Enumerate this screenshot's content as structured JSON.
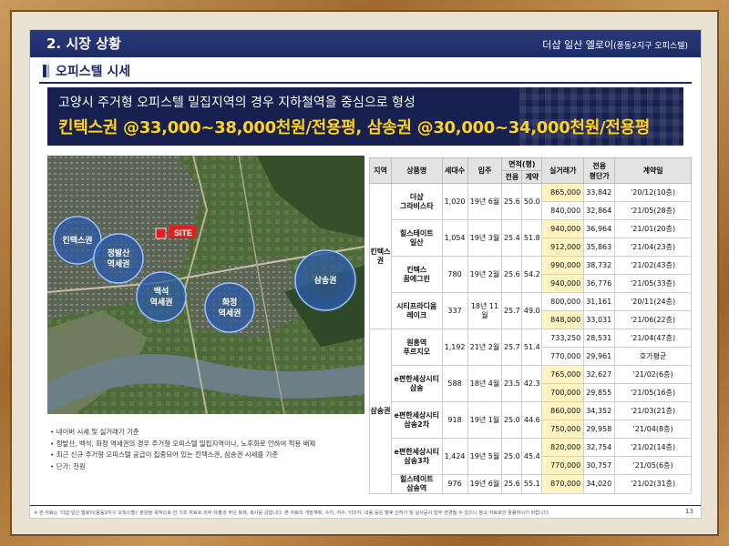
{
  "header": {
    "section": "2. 시장 상황",
    "project_main": "더샵 일산 엘로이",
    "project_sub": "(풍동2지구 오피스텔)"
  },
  "subheader": "오피스텔 시세",
  "banner": {
    "line1": "고양시 주거형 오피스텔 밀집지역의 경우 지하철역을 중심으로 형성",
    "line2": "킨텍스권 @33,000~38,000천원/전용평, 삼송권 @30,000~34,000천원/전용평"
  },
  "map": {
    "labels": {
      "kintex": "킨텍스권",
      "jeongbalsan": "정발산\n역세권",
      "baekseok": "백석\n역세권",
      "hwajeong": "화정\n역세권",
      "samsong": "삼송권",
      "site": "SITE"
    },
    "colors": {
      "circle": "#2c5aa8",
      "site": "#e02020"
    }
  },
  "notes": [
    "네이버 시세 및 실거래가 기준",
    "정발산, 백석, 화정 역세권의 경우 주거형 오피스텔 밀집지역이나, 노후화로 인하여 적용 배제",
    "최근 신규 주거형 오피스텔 공급이 집중되어 있는 킨텍스권, 삼송권 시세를 기준",
    "단가: 천원"
  ],
  "table": {
    "headers": {
      "region": "지역",
      "name": "상품명",
      "units": "세대수",
      "movein": "입주",
      "area": "면적(평)",
      "excl": "전용",
      "contract": "계약",
      "price": "실거래가",
      "per_py": "전용\n평단가",
      "date": "계약일"
    },
    "groups": [
      {
        "region": "킨텍스\n권",
        "items": [
          {
            "name": "더샵\n그라비스타",
            "units": "1,020",
            "movein": "19년 6월",
            "excl": "25.6",
            "contract": "50.0",
            "rows": [
              {
                "price": "865,000",
                "per_py": "33,842",
                "date": "'20/12(10층)",
                "hl": true
              },
              {
                "price": "840,000",
                "per_py": "32,864",
                "date": "'21/05(28층)",
                "hl": false
              }
            ]
          },
          {
            "name": "힐스테이트\n일산",
            "units": "1,054",
            "movein": "19년 3월",
            "excl": "25.4",
            "contract": "51.8",
            "rows": [
              {
                "price": "940,000",
                "per_py": "36,964",
                "date": "'21/01(20층)",
                "hl": true
              },
              {
                "price": "912,000",
                "per_py": "35,863",
                "date": "'21/04(23층)",
                "hl": true
              }
            ]
          },
          {
            "name": "킨텍스\n꿈에그린",
            "units": "780",
            "movein": "19년 2월",
            "excl": "25.6",
            "contract": "54.2",
            "rows": [
              {
                "price": "990,000",
                "per_py": "38,732",
                "date": "'21/02(43층)",
                "hl": true
              },
              {
                "price": "940,000",
                "per_py": "36,776",
                "date": "'21/05(33층)",
                "hl": true
              }
            ]
          },
          {
            "name": "시티프라디움\n레이크",
            "units": "337",
            "movein": "18년 11월",
            "excl": "25.7",
            "contract": "49.0",
            "rows": [
              {
                "price": "800,000",
                "per_py": "31,161",
                "date": "'20/11(24층)",
                "hl": false
              },
              {
                "price": "848,000",
                "per_py": "33,031",
                "date": "'21/06(22층)",
                "hl": true
              }
            ]
          }
        ]
      },
      {
        "region": "삼송권",
        "items": [
          {
            "name": "원흥역\n푸르지오",
            "units": "1,192",
            "movein": "21년 2월",
            "excl": "25.7",
            "contract": "51.4",
            "rows": [
              {
                "price": "733,250",
                "per_py": "28,531",
                "date": "'21/04(47층)",
                "hl": false
              },
              {
                "price": "770,000",
                "per_py": "29,961",
                "date": "호가평균",
                "hl": false
              }
            ]
          },
          {
            "name": "e편한세상시티\n삼송",
            "units": "588",
            "movein": "18년 4월",
            "excl": "23.5",
            "contract": "42.3",
            "rows": [
              {
                "price": "765,000",
                "per_py": "32,627",
                "date": "'21/02(6층)",
                "hl": true
              },
              {
                "price": "700,000",
                "per_py": "29,855",
                "date": "'21/05(16층)",
                "hl": true
              }
            ]
          },
          {
            "name": "e편한세상시티\n삼송2차",
            "units": "918",
            "movein": "19년 1월",
            "excl": "25.0",
            "contract": "44.6",
            "rows": [
              {
                "price": "860,000",
                "per_py": "34,352",
                "date": "'21/03(21층)",
                "hl": true
              },
              {
                "price": "750,000",
                "per_py": "29,958",
                "date": "'21/04(8층)",
                "hl": true
              }
            ]
          },
          {
            "name": "e편한세상시티\n삼송3차",
            "units": "1,424",
            "movein": "19년 5월",
            "excl": "25.0",
            "contract": "45.4",
            "rows": [
              {
                "price": "820,000",
                "per_py": "32,754",
                "date": "'21/02(14층)",
                "hl": true
              },
              {
                "price": "770,000",
                "per_py": "30,757",
                "date": "'21/05(6층)",
                "hl": true
              }
            ]
          },
          {
            "name": "힐스테이트\n삼송역",
            "units": "976",
            "movein": "19년 6월",
            "excl": "25.6",
            "contract": "55.1",
            "rows": [
              {
                "price": "870,000",
                "per_py": "34,020",
                "date": "'21/02(31층)",
                "hl": true
              }
            ]
          }
        ]
      }
    ]
  },
  "footer": {
    "disclaimer": "※ 본 자료는 '더샵 일산 엘로이(풍동2지구 오피스텔)' 분양을 목적으로 한 기초 자료로 외부 유출과 무단 복제, 복사를 금합니다. 본 자료의 개발계획, 수치, 지수, 이미지, 내용 등은 향후 인허가 및 실사공시 일부 변경될 수 있으니 참고 자료로만 활용하시기 바랍니다.",
    "page": "13"
  }
}
